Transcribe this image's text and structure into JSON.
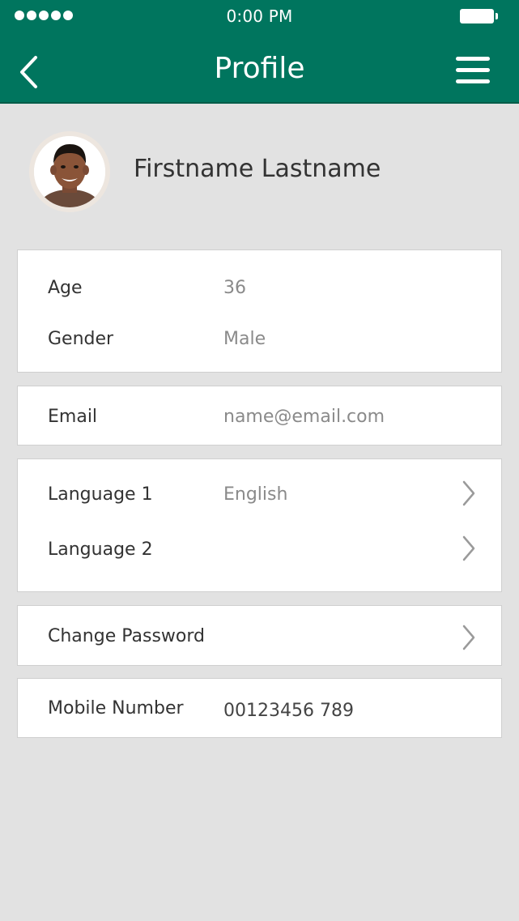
{
  "status_bar": {
    "time": "0:00 PM"
  },
  "header": {
    "title": "Profile"
  },
  "profile": {
    "name": "Firstname Lastname"
  },
  "details": {
    "age_label": "Age",
    "age_value": "36",
    "gender_label": "Gender",
    "gender_value": "Male"
  },
  "contact": {
    "email_label": "Email",
    "email_value": "name@email.com"
  },
  "languages": {
    "language1_label": "Language 1",
    "language1_value": "English",
    "language2_label": "Language 2"
  },
  "security": {
    "change_password_label": "Change Password"
  },
  "mobile": {
    "label": "Mobile Number",
    "value": "00123456 789"
  },
  "colors": {
    "header": "#00755e",
    "background": "#e2e2e2"
  },
  "icons": [
    "back-chevron-icon",
    "hamburger-menu-icon",
    "chevron-right-icon",
    "battery-icon",
    "signal-dots-icon"
  ]
}
